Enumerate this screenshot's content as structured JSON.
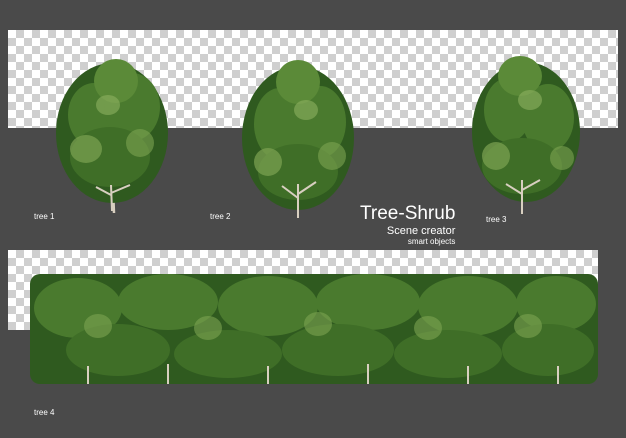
{
  "labels": {
    "tree1": "tree 1",
    "tree2": "tree 2",
    "tree3": "tree 3",
    "tree4": "tree 4"
  },
  "brand": {
    "title": "Tree-Shrub",
    "subtitle": "Scene creator",
    "tagline": "smart objects"
  },
  "colors": {
    "background": "#4a4a4a",
    "foliage_dark": "#2f5a1f",
    "foliage_mid": "#4a7a2e",
    "foliage_light": "#7da352",
    "trunk": "#d8cfc0",
    "text": "#ffffff"
  }
}
